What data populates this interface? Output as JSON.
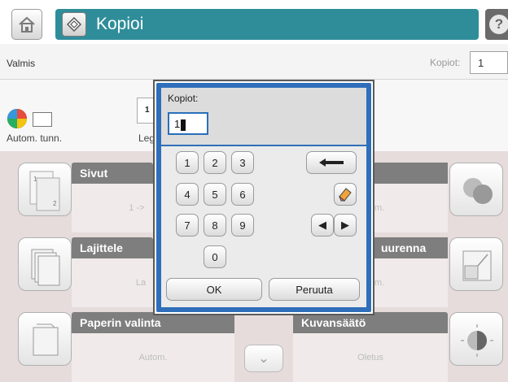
{
  "header": {
    "title": "Kopioi",
    "home_icon": "home-icon",
    "copy_icon": "copy-icon",
    "help_label": "?"
  },
  "status": {
    "text": "Valmis",
    "copies_label": "Kopiot:",
    "copies_value": "1"
  },
  "strip": {
    "color_mode_label": "Autom. tunn.",
    "sides_thumb_number": "1",
    "sides_label_partial": "Leg"
  },
  "tiles": [
    {
      "title": "Sivut",
      "value": "1 ->",
      "icon": "sides-icon"
    },
    {
      "title": "Lajittele",
      "value": "La",
      "icon": "collate-icon"
    },
    {
      "title": "Paperin valinta",
      "value": "Autom.",
      "icon": "paper-select-icon"
    },
    {
      "title": "",
      "value": "m.",
      "icon": "color-icon"
    },
    {
      "title": "uurenna",
      "value": "m.",
      "icon": "reduce-enlarge-icon"
    },
    {
      "title": "Kuvansäätö",
      "value": "Oletus",
      "icon": "image-adjust-icon"
    }
  ],
  "dialog": {
    "label": "Kopiot:",
    "input_value": "1",
    "keys": [
      "1",
      "2",
      "3",
      "4",
      "5",
      "6",
      "7",
      "8",
      "9",
      "0"
    ],
    "ok_label": "OK",
    "cancel_label": "Peruuta"
  },
  "colors": {
    "title_bar": "#2f8d9a",
    "dialog_frame": "#2f6fba",
    "tile_header": "#7e7e7e"
  }
}
